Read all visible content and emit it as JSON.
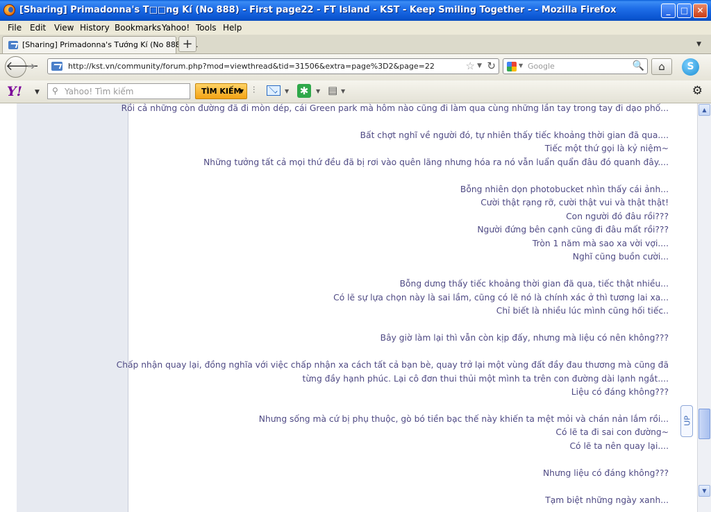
{
  "window": {
    "title": "[Sharing] Primadonna's T□□ng Kí (No 888) - First page22 - FT Island - KST - Keep Smiling Together - - Mozilla Firefox"
  },
  "menu": [
    "File",
    "Edit",
    "View",
    "History",
    "Bookmarks",
    "Yahoo!",
    "Tools",
    "Help"
  ],
  "tab": {
    "label": "[Sharing] Primadonna's Tướng Kí (No 888) - ..."
  },
  "nav": {
    "url": "http://kst.vn/community/forum.php?mod=viewthread&tid=31506&extra=page%3D2&page=22",
    "search_placeholder": "Google"
  },
  "yahoo": {
    "logo": "Y!",
    "search_placeholder": "Yahoo! Tìm kiếm",
    "search_button": "TÌM KIẾM"
  },
  "content": {
    "lines": [
      "Rồi cả những còn đường đã đi mòn dép, cái Green park mà hôm nào cũng đi làm qua cùng những lần tay trong tay đi dạo phố...",
      "",
      "Bất chợt nghĩ về người đó, tự nhiên thấy tiếc khoảng thời gian đã qua....",
      "Tiếc một thứ gọi là kỷ niệm~",
      "Những tưởng tất cả mọi thứ đều đã bị rơi vào quên lãng nhưng hóa ra nó vẫn luẩn quẩn đâu đó quanh đây....",
      "",
      "Bỗng nhiên dọn photobucket nhìn thấy cái ảnh...",
      "Cười thật rạng rỡ, cười thật vui và thật thật!",
      "Con người đó đâu rồi???",
      "Người đứng bên cạnh cũng đi đâu mất rồi???",
      "Tròn 1 năm mà sao xa vời vợi....",
      "Nghĩ cũng buồn cười...",
      "",
      "Bỗng dưng thấy tiếc khoảng thời gian đã qua, tiếc thật nhiều...",
      "Có lẽ sự lựa chọn này là sai lầm, cũng có lẽ nó là chính xác ở thì tương lai xa...",
      "Chỉ biết là nhiều lúc mình cũng hối tiếc..",
      "",
      "Bây giờ làm lại thì vẫn còn kịp đấy, nhưng mà liệu có nên không???",
      "",
      "Chấp nhận quay lại, đồng nghĩa với việc chấp nhận xa cách tất cả bạn bè, quay trở lại một vùng đất đầy đau thương mà cũng đã",
      "từng đầy hạnh phúc. Lại cô đơn thui thủi một mình ta trên con đường dài lạnh ngắt....",
      "Liệu có đáng không???",
      "",
      "Nhưng sống mà cứ bị phụ thuộc, gò bó tiền bạc thế này khiến ta mệt mỏi và chán nản lắm rồi...",
      "Có lẽ ta đi sai con đường~",
      "Có lẽ ta nên quay lại....",
      "",
      "Nhưng liệu có đáng không???",
      "",
      "Tạm biệt những ngày xanh..."
    ],
    "up_button": "UP"
  }
}
